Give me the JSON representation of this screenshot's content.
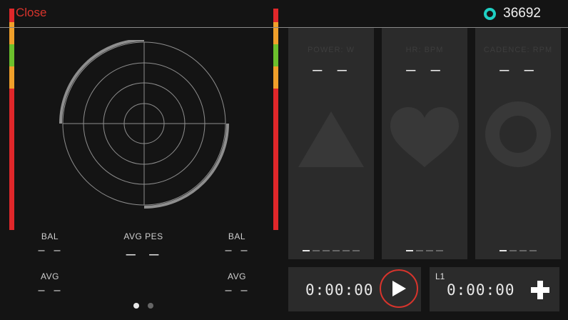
{
  "header": {
    "close_label": "Close",
    "count": "36692",
    "count_icon": "ring-icon",
    "accent_close": "#d8342c",
    "accent_ring": "#1fd0c4"
  },
  "level_bars": {
    "colors": [
      "#e0272a",
      "#f0a02a",
      "#6cc02c",
      "#f0a02a",
      "#e0272a"
    ]
  },
  "left_stats": {
    "bal_left": {
      "label": "BAL",
      "value": "– –"
    },
    "avg_left": {
      "label": "AVG",
      "value": "– –"
    },
    "avg_pes": {
      "label": "AVG PES",
      "value": "– –"
    },
    "bal_right": {
      "label": "BAL",
      "value": "– –"
    },
    "avg_right": {
      "label": "AVG",
      "value": "– –"
    }
  },
  "pager": {
    "count": 2,
    "active": 0
  },
  "panels": [
    {
      "title": "POWER: W",
      "value": "– –",
      "icon": "triangle-icon"
    },
    {
      "title": "HR: BPM",
      "value": "– –",
      "icon": "heart-icon"
    },
    {
      "title": "CADENCE: RPM",
      "value": "– –",
      "icon": "ring-shape-icon"
    }
  ],
  "timers": {
    "elapsed": "0:00:00",
    "lap_label": "L1",
    "lap_time": "0:00:00",
    "play_icon": "play-icon",
    "add_icon": "plus-icon"
  }
}
